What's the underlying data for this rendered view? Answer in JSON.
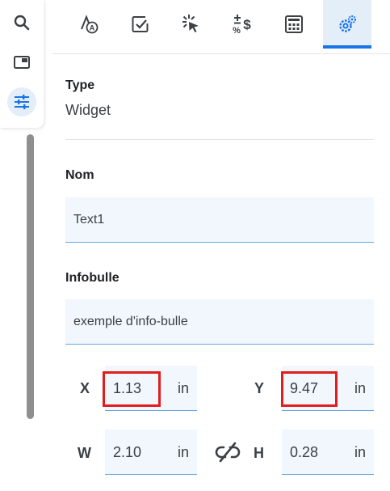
{
  "rail": {
    "items": [
      {
        "icon": "search-icon"
      },
      {
        "icon": "picture-in-picture-icon"
      },
      {
        "icon": "tune-sliders-icon",
        "active": true
      }
    ]
  },
  "toolbar": {
    "tools": [
      {
        "icon": "text-format-icon"
      },
      {
        "icon": "checkbox-icon"
      },
      {
        "icon": "cursor-click-icon"
      },
      {
        "icon": "plus-minus-percent-dollar-icon"
      },
      {
        "icon": "calculator-icon"
      },
      {
        "icon": "gears-icon",
        "active": true
      }
    ],
    "active_color": "#1a73e8"
  },
  "panel": {
    "type_label": "Type",
    "type_value": "Widget",
    "name_label": "Nom",
    "name_value": "Text1",
    "tooltip_label": "Infobulle",
    "tooltip_value": "exemple d'info-bulle",
    "x_label": "X",
    "x_value": "1.13",
    "x_unit": "in",
    "y_label": "Y",
    "y_value": "9.47",
    "y_unit": "in",
    "w_label": "W",
    "w_value": "2.10",
    "w_unit": "in",
    "h_label": "H",
    "h_value": "0.28",
    "h_unit": "in",
    "link_icon": "link-off-icon"
  },
  "colors": {
    "field_bg": "#f1f7fd",
    "field_underline": "#6aa7dd",
    "highlight": "#e01e1e"
  }
}
